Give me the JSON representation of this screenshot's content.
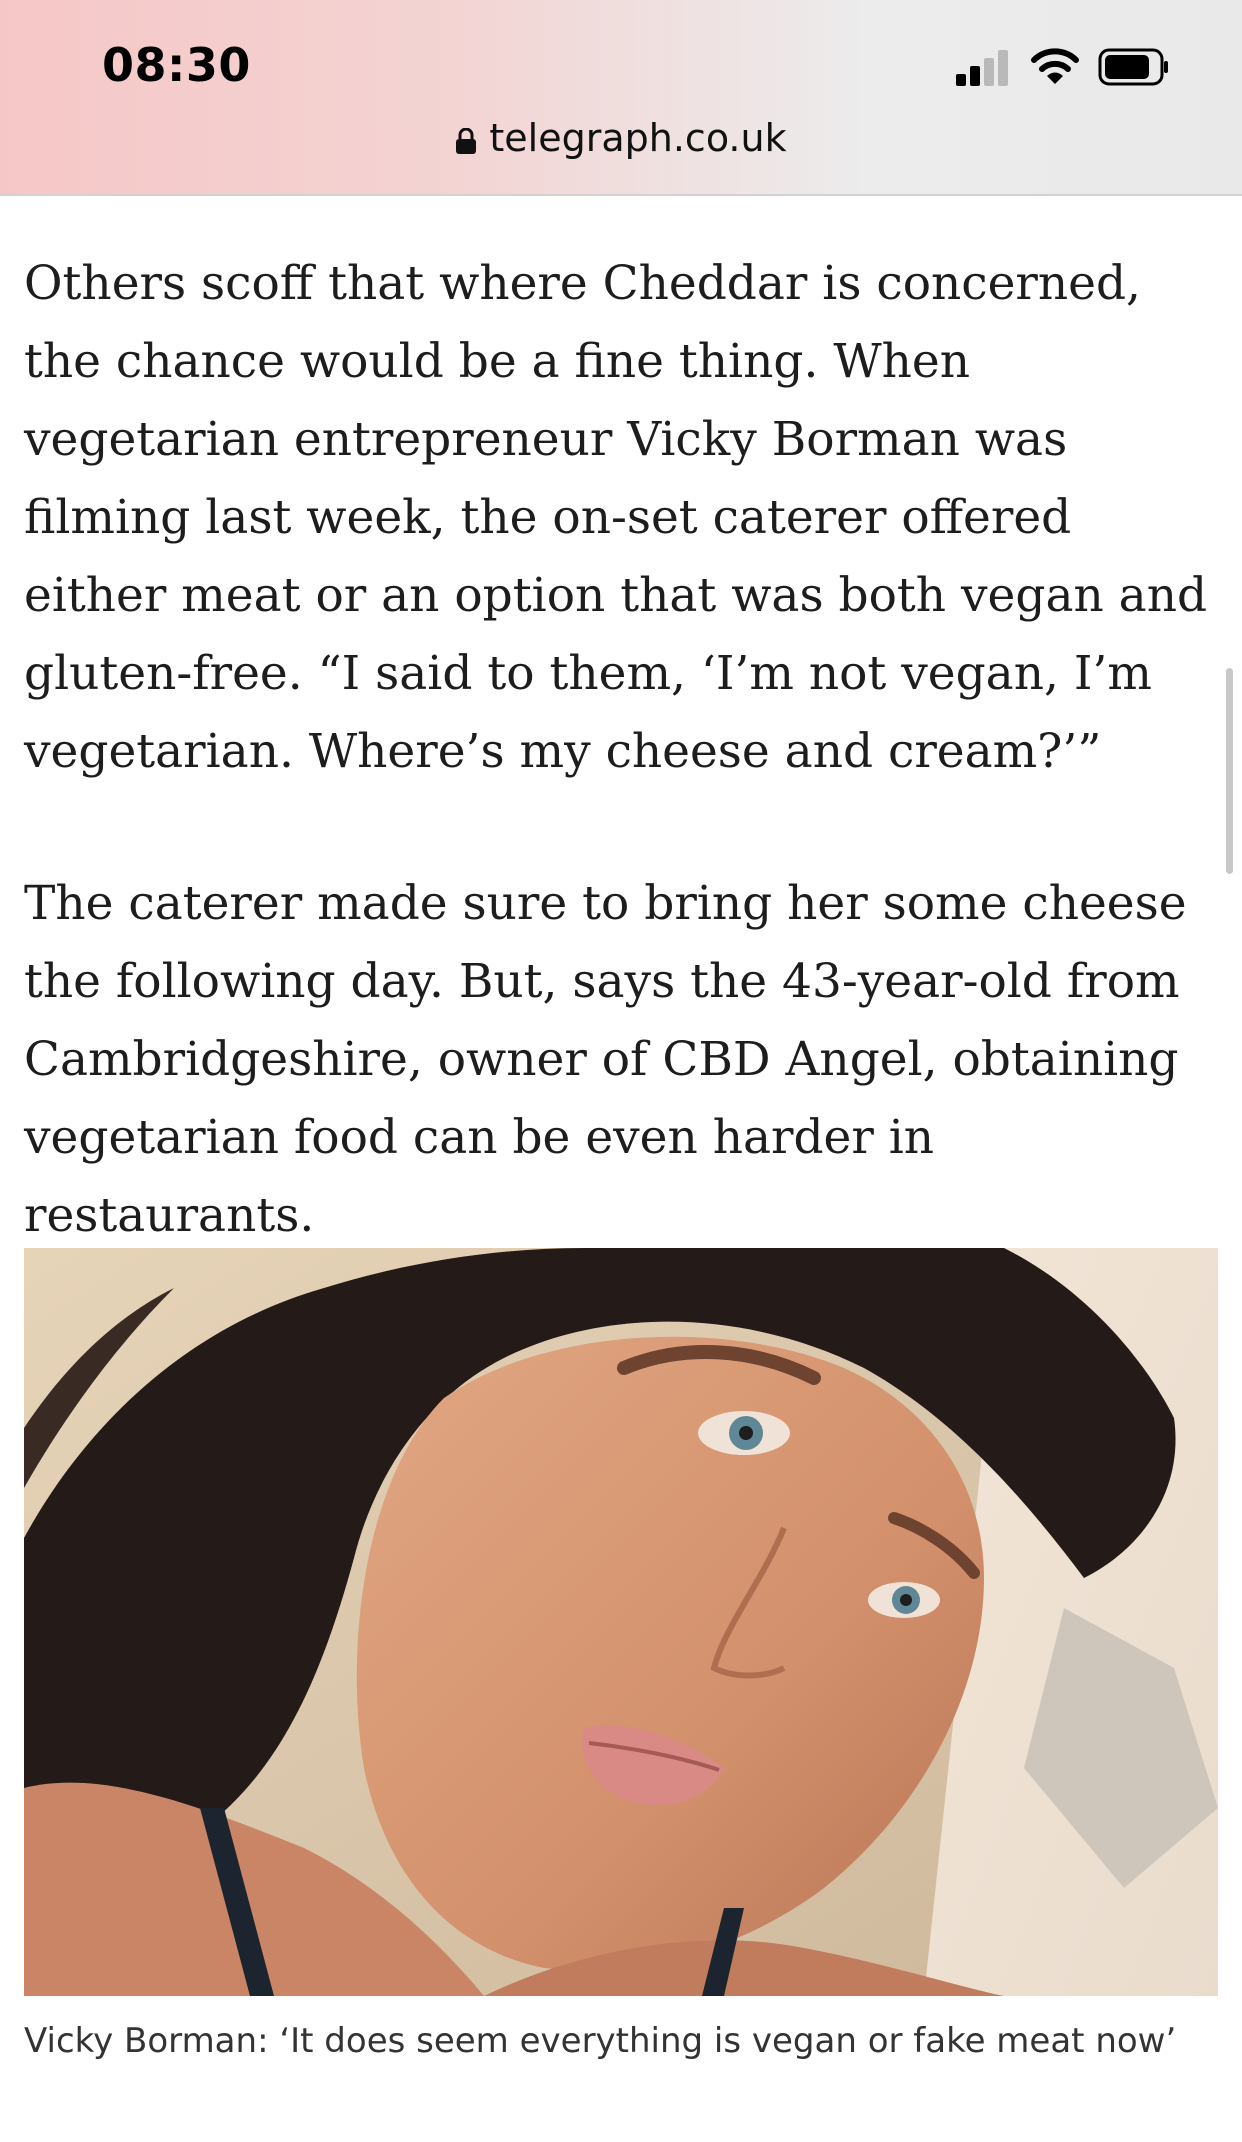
{
  "status_bar": {
    "time": "08:30",
    "icons": [
      "cellular-signal-icon",
      "wifi-icon",
      "battery-icon"
    ]
  },
  "address_bar": {
    "lock_icon": "lock-icon",
    "domain": "telegraph.co.uk"
  },
  "article": {
    "paragraphs": [
      "Others scoff that where Cheddar is concerned, the chance would be a fine thing. When vegetarian entrepreneur Vicky Borman was filming last week, the on-set caterer offered either meat or an option that was both vegan and gluten-free. “I said to them, ‘I’m not vegan, I’m vegetarian. Where’s my cheese and cream?’”",
      "The caterer made sure to bring her some cheese the following day. But, says the 43-year-old from Cambridgeshire, owner of CBD Angel, obtaining vegetarian food can be even harder in restaurants."
    ],
    "image_caption": "Vicky Borman: ‘It does seem everything is vegan or fake meat now’"
  },
  "colors": {
    "text": "#1d1d1d",
    "caption": "#333333",
    "status_gradient_left": "#f6c7c7",
    "status_gradient_right": "#e9e9e9"
  }
}
